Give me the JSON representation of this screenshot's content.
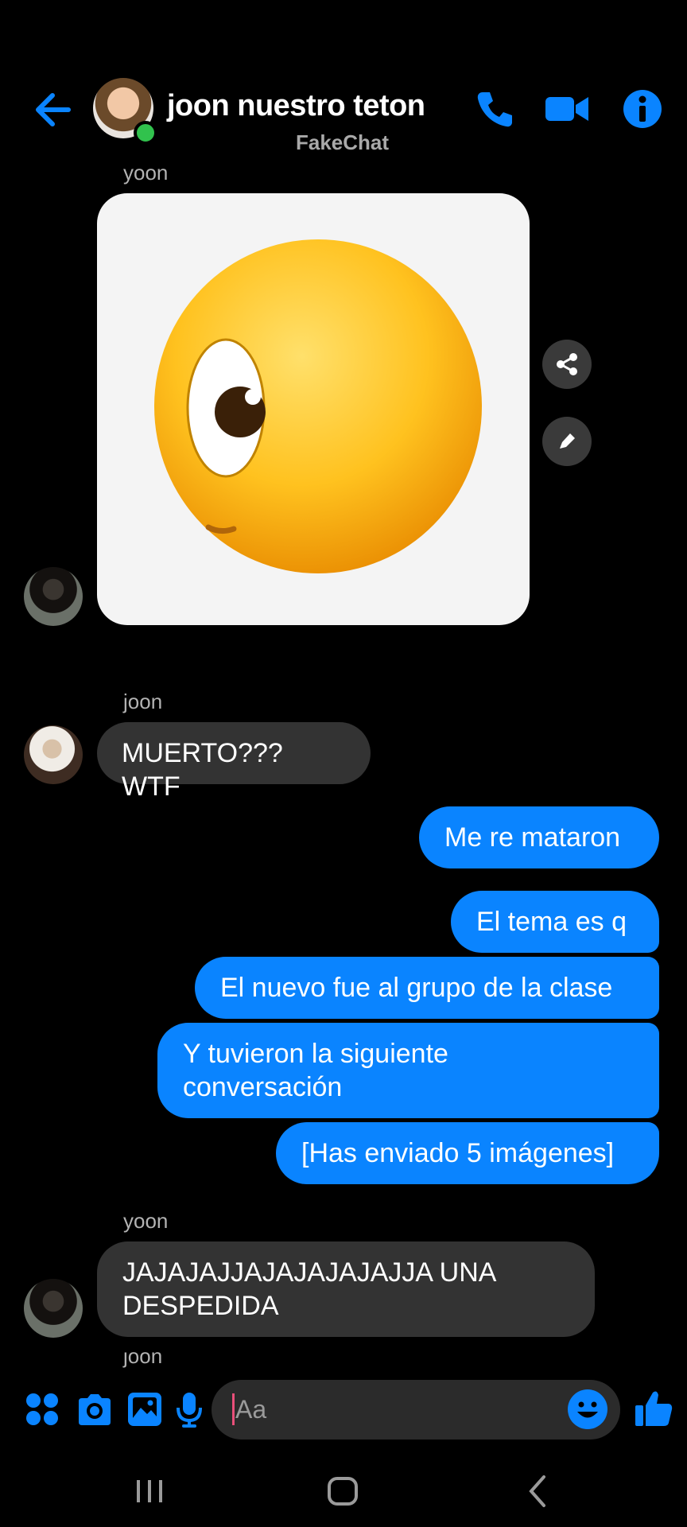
{
  "header": {
    "title": "joon nuestro teton",
    "subtitle": "FakeChat"
  },
  "messages": {
    "m1": {
      "sender": "yoon"
    },
    "m2": {
      "sender": "joon",
      "text": "MUERTO??? WTF"
    },
    "m3": {
      "text": "Me re mataron"
    },
    "m4": {
      "text": "El tema es q"
    },
    "m5": {
      "text": "El nuevo fue al grupo de la clase"
    },
    "m6": {
      "line1": "Y tuvieron la siguiente",
      "line2": "conversación"
    },
    "m7": {
      "text": "[Has enviado 5 imágenes]"
    },
    "m8": {
      "sender": "yoon",
      "line1": "JAJAJAJJAJAJAJAJAJJA UNA",
      "line2": "DESPEDIDA"
    },
    "m9": {
      "sender": "joon"
    }
  },
  "composer": {
    "placeholder": "Aa"
  },
  "colors": {
    "accent": "#0a84ff",
    "bubble_grey": "#333333",
    "online": "#31c24d"
  },
  "icons": [
    "back-arrow-icon",
    "phone-icon",
    "video-camera-icon",
    "info-icon",
    "share-icon",
    "edit-pencil-icon",
    "apps-grid-icon",
    "camera-icon",
    "gallery-icon",
    "microphone-icon",
    "emoji-icon",
    "thumbs-up-icon",
    "nav-recents-icon",
    "nav-home-icon",
    "nav-back-icon"
  ]
}
